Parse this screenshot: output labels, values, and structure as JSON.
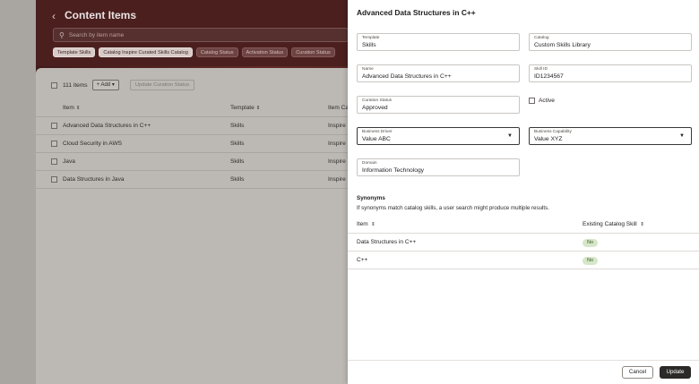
{
  "background": {
    "page_title": "Content Items",
    "search_placeholder": "Search by item name",
    "filter_chips": [
      {
        "label": "Template Skills",
        "active": true
      },
      {
        "label": "Catalog Inspire Curated Skills Catalog",
        "active": true
      },
      {
        "label": "Catalog Status",
        "active": false
      },
      {
        "label": "Activation Status",
        "active": false
      },
      {
        "label": "Curation Status",
        "active": false
      }
    ],
    "item_count": "111 items",
    "add_label": "Add",
    "update_curation_label": "Update Curation Status",
    "columns": {
      "item": "Item",
      "template": "Template",
      "catalog": "Item Ca"
    },
    "rows": [
      {
        "item": "Advanced Data Structures in C++",
        "template": "Skills",
        "catalog": "Inspire"
      },
      {
        "item": "Cloud Security in AWS",
        "template": "Skills",
        "catalog": "Inspire"
      },
      {
        "item": "Java",
        "template": "Skills",
        "catalog": "Inspire"
      },
      {
        "item": "Data Structures in Java",
        "template": "Skills",
        "catalog": "Inspire"
      }
    ]
  },
  "drawer": {
    "title": "Advanced Data Structures in C++",
    "fields": {
      "template": {
        "label": "Template",
        "value": "Skills"
      },
      "catalog": {
        "label": "Catalog",
        "value": "Custom Skills Library"
      },
      "name": {
        "label": "Name",
        "value": "Advanced Data Structures in C++"
      },
      "skill_id": {
        "label": "Skill ID",
        "value": "ID1234567"
      },
      "curation_status": {
        "label": "Curation Status",
        "value": "Approved"
      },
      "active": {
        "label": "Active",
        "checked": false
      },
      "business_driver": {
        "label": "Business Driver",
        "value": "Value ABC"
      },
      "business_capability": {
        "label": "Business Capability",
        "value": "Value XYZ"
      },
      "domain": {
        "label": "Domain",
        "value": "Information Technology"
      }
    },
    "synonyms": {
      "title": "Synonyms",
      "description": "If synonyms match catalog skills,  a user search  might produce multiple results.",
      "columns": {
        "item": "Item",
        "existing": "Existing Catalog Skill"
      },
      "rows": [
        {
          "item": "Data Structures in C++",
          "existing": "No"
        },
        {
          "item": "C++",
          "existing": "No"
        }
      ]
    },
    "cancel_label": "Cancel",
    "update_label": "Update"
  }
}
